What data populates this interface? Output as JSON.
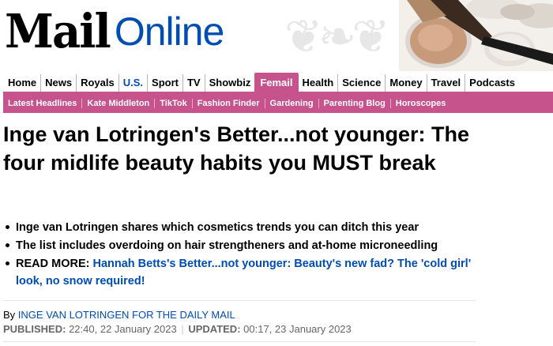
{
  "masthead": {
    "logo_mail": "Mail",
    "logo_online": "Online"
  },
  "nav": {
    "items": [
      "Home",
      "News",
      "Royals",
      "U.S.",
      "Sport",
      "TV",
      "Showbiz",
      "Femail",
      "Health",
      "Science",
      "Money",
      "Travel",
      "Podcasts"
    ],
    "active": "Femail"
  },
  "subnav": {
    "items": [
      "Latest Headlines",
      "Kate Middleton",
      "TikTok",
      "Fashion Finder",
      "Gardening",
      "Parenting Blog",
      "Horoscopes"
    ]
  },
  "article": {
    "headline": "Inge van Lotringen's Better...not younger: The four midlife beauty habits you MUST break",
    "bullets": [
      "Inge van Lotringen shares which cosmetics trends you can ditch this year",
      "The list includes overdoing on hair strengtheners and at-home microneedling"
    ],
    "read_more_label": "READ MORE:",
    "read_more_link": "Hannah Betts's Better...not younger: Beauty's new fad? The 'cold girl' look, no snow required!",
    "byline_prefix": "By",
    "byline_author": "INGE VAN LOTRINGEN FOR THE DAILY MAIL",
    "published_label": "PUBLISHED:",
    "published_value": "22:40, 22 January 2023",
    "updated_label": "UPDATED:",
    "updated_value": "00:17, 23 January 2023"
  },
  "colors": {
    "femail_pink": "#c6538c",
    "link_blue": "#004db3"
  }
}
